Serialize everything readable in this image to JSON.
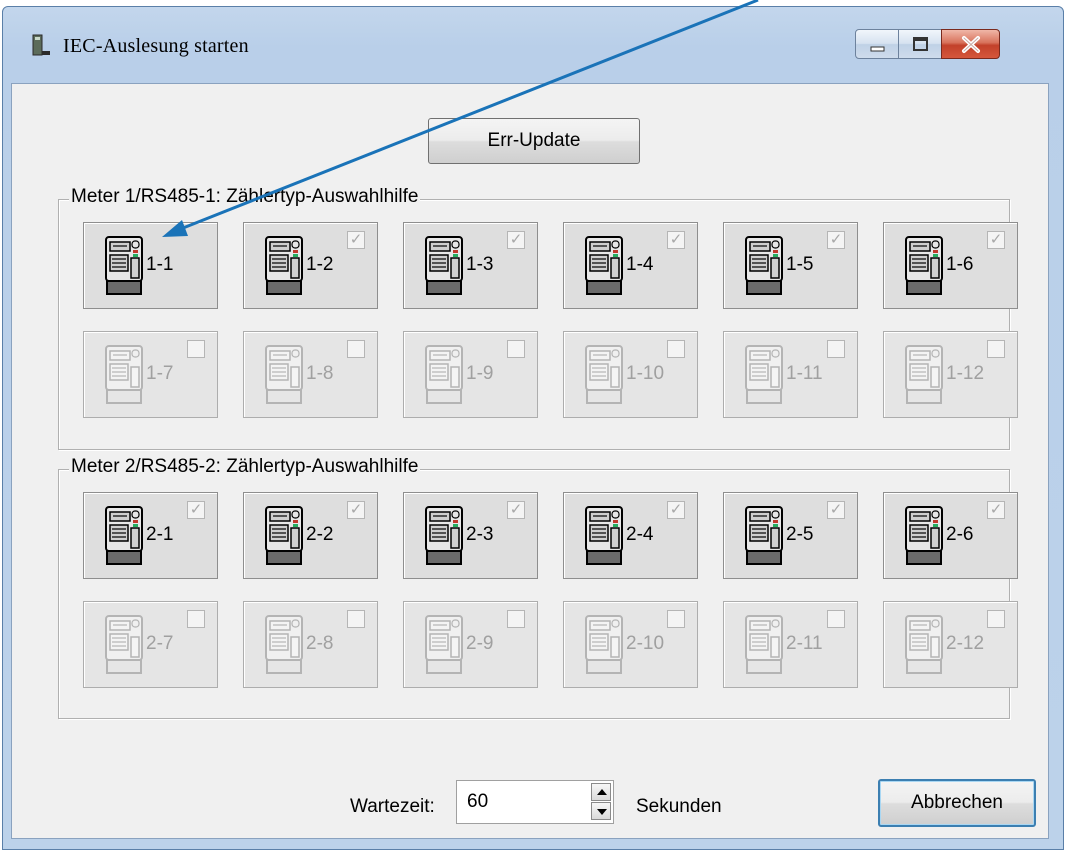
{
  "window": {
    "title": "IEC-Auslesung starten"
  },
  "toolbar": {
    "err_update_label": "Err-Update"
  },
  "groups": [
    {
      "title": "Meter 1/RS485-1: Zählertyp-Auswahlhilfe",
      "buttons": [
        {
          "label": "1-1",
          "enabled": true,
          "checkbox": false
        },
        {
          "label": "1-2",
          "enabled": true,
          "checkbox": true
        },
        {
          "label": "1-3",
          "enabled": true,
          "checkbox": true
        },
        {
          "label": "1-4",
          "enabled": true,
          "checkbox": true
        },
        {
          "label": "1-5",
          "enabled": true,
          "checkbox": true
        },
        {
          "label": "1-6",
          "enabled": true,
          "checkbox": true
        },
        {
          "label": "1-7",
          "enabled": false,
          "checkbox": false
        },
        {
          "label": "1-8",
          "enabled": false,
          "checkbox": false
        },
        {
          "label": "1-9",
          "enabled": false,
          "checkbox": false
        },
        {
          "label": "1-10",
          "enabled": false,
          "checkbox": false
        },
        {
          "label": "1-11",
          "enabled": false,
          "checkbox": false
        },
        {
          "label": "1-12",
          "enabled": false,
          "checkbox": false
        }
      ]
    },
    {
      "title": "Meter 2/RS485-2: Zählertyp-Auswahlhilfe",
      "buttons": [
        {
          "label": "2-1",
          "enabled": true,
          "checkbox": true
        },
        {
          "label": "2-2",
          "enabled": true,
          "checkbox": true
        },
        {
          "label": "2-3",
          "enabled": true,
          "checkbox": true
        },
        {
          "label": "2-4",
          "enabled": true,
          "checkbox": true
        },
        {
          "label": "2-5",
          "enabled": true,
          "checkbox": true
        },
        {
          "label": "2-6",
          "enabled": true,
          "checkbox": true
        },
        {
          "label": "2-7",
          "enabled": false,
          "checkbox": false
        },
        {
          "label": "2-8",
          "enabled": false,
          "checkbox": false
        },
        {
          "label": "2-9",
          "enabled": false,
          "checkbox": false
        },
        {
          "label": "2-10",
          "enabled": false,
          "checkbox": false
        },
        {
          "label": "2-11",
          "enabled": false,
          "checkbox": false
        },
        {
          "label": "2-12",
          "enabled": false,
          "checkbox": false
        }
      ]
    }
  ],
  "footer": {
    "wait_label": "Wartezeit:",
    "wait_value": "60",
    "unit_label": "Sekunden",
    "cancel_label": "Abbrechen"
  },
  "colors": {
    "annotation_arrow": "#1a73b8",
    "close_button": "#c2412a"
  }
}
